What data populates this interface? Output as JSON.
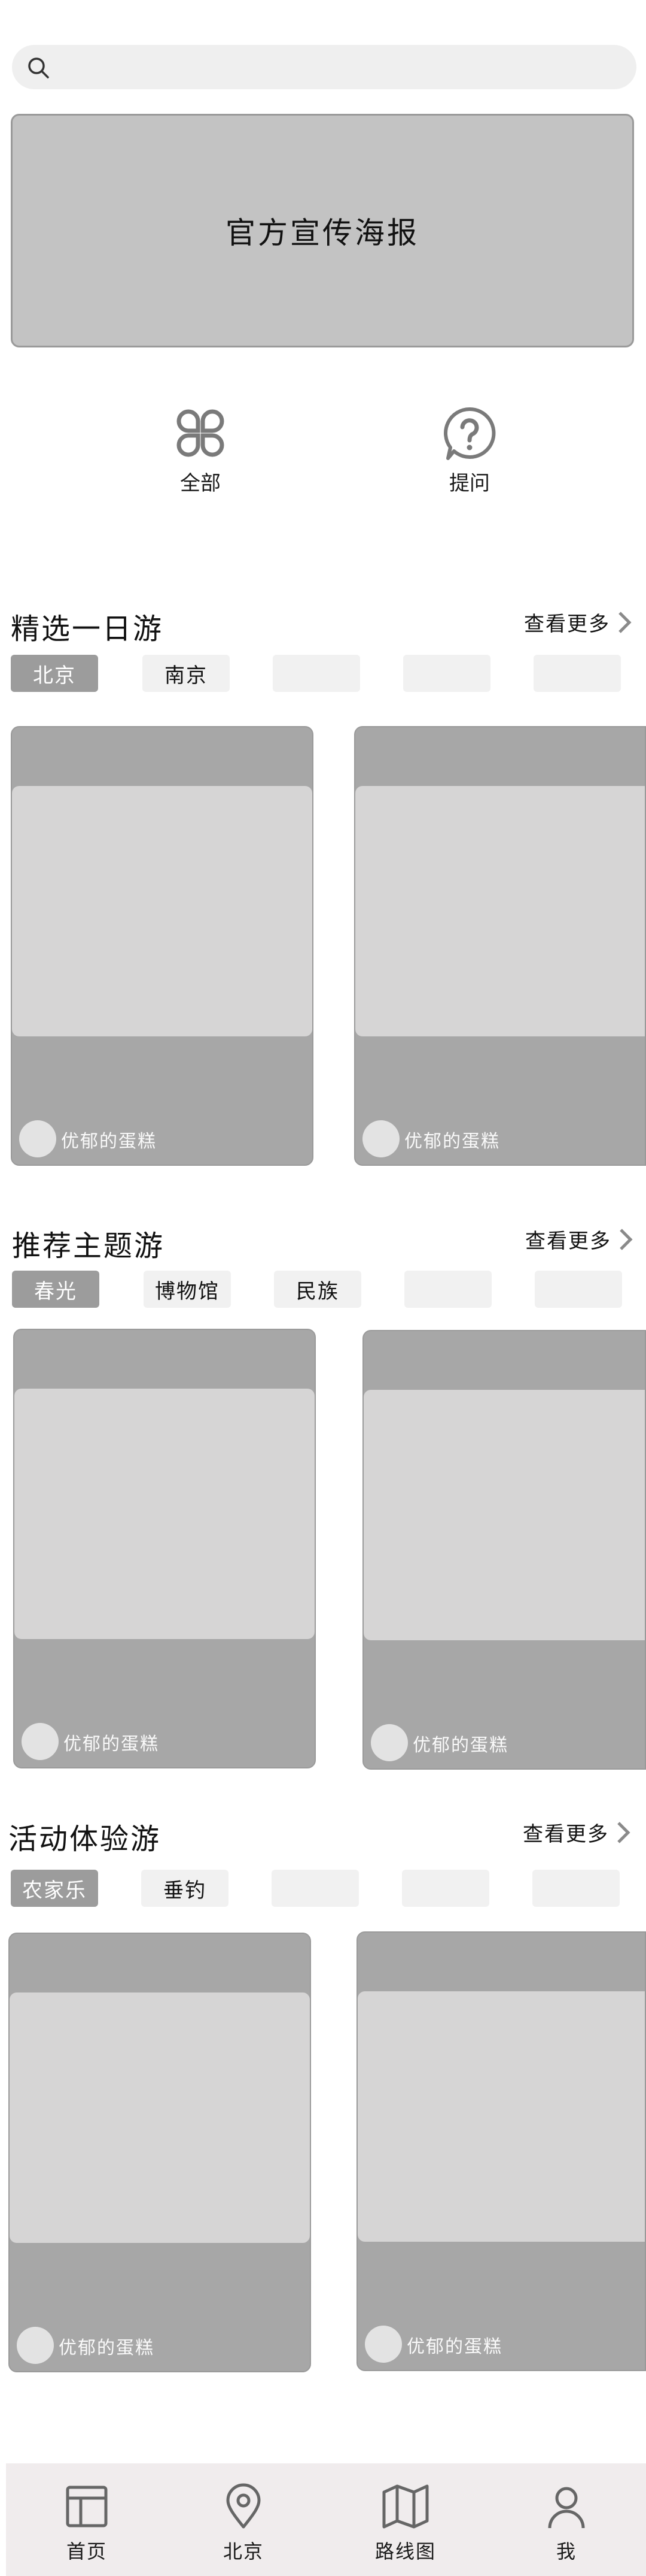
{
  "search": {
    "placeholder": ""
  },
  "banner": {
    "text": "官方宣传海报"
  },
  "quick_links": [
    {
      "label": "全部",
      "icon": "grid-icon"
    },
    {
      "label": "提问",
      "icon": "question-icon"
    }
  ],
  "sections": [
    {
      "title": "精选一日游",
      "more": "查看更多",
      "tags": [
        "北京",
        "南京",
        "",
        "",
        ""
      ],
      "cards": [
        {
          "author": "优郁的蛋糕"
        },
        {
          "author": "优郁的蛋糕"
        }
      ]
    },
    {
      "title": "推荐主题游",
      "more": "查看更多",
      "tags": [
        "春光",
        "博物馆",
        "民族",
        "",
        ""
      ],
      "cards": [
        {
          "author": "优郁的蛋糕"
        },
        {
          "author": "优郁的蛋糕"
        }
      ]
    },
    {
      "title": "活动体验游",
      "more": "查看更多",
      "tags": [
        "农家乐",
        "垂钓",
        "",
        "",
        ""
      ],
      "cards": [
        {
          "author": "优郁的蛋糕"
        },
        {
          "author": "优郁的蛋糕"
        }
      ]
    }
  ],
  "bottom_nav": [
    {
      "label": "首页",
      "icon": "home-layout-icon"
    },
    {
      "label": "北京",
      "icon": "location-pin-icon"
    },
    {
      "label": "路线图",
      "icon": "map-icon"
    },
    {
      "label": "我",
      "icon": "user-icon"
    }
  ],
  "colors": {
    "active_tag": "#9c9c9c",
    "card_bg": "#a7a7a7",
    "card_image": "#d6d5d5",
    "nav_bg": "#f0eced"
  }
}
